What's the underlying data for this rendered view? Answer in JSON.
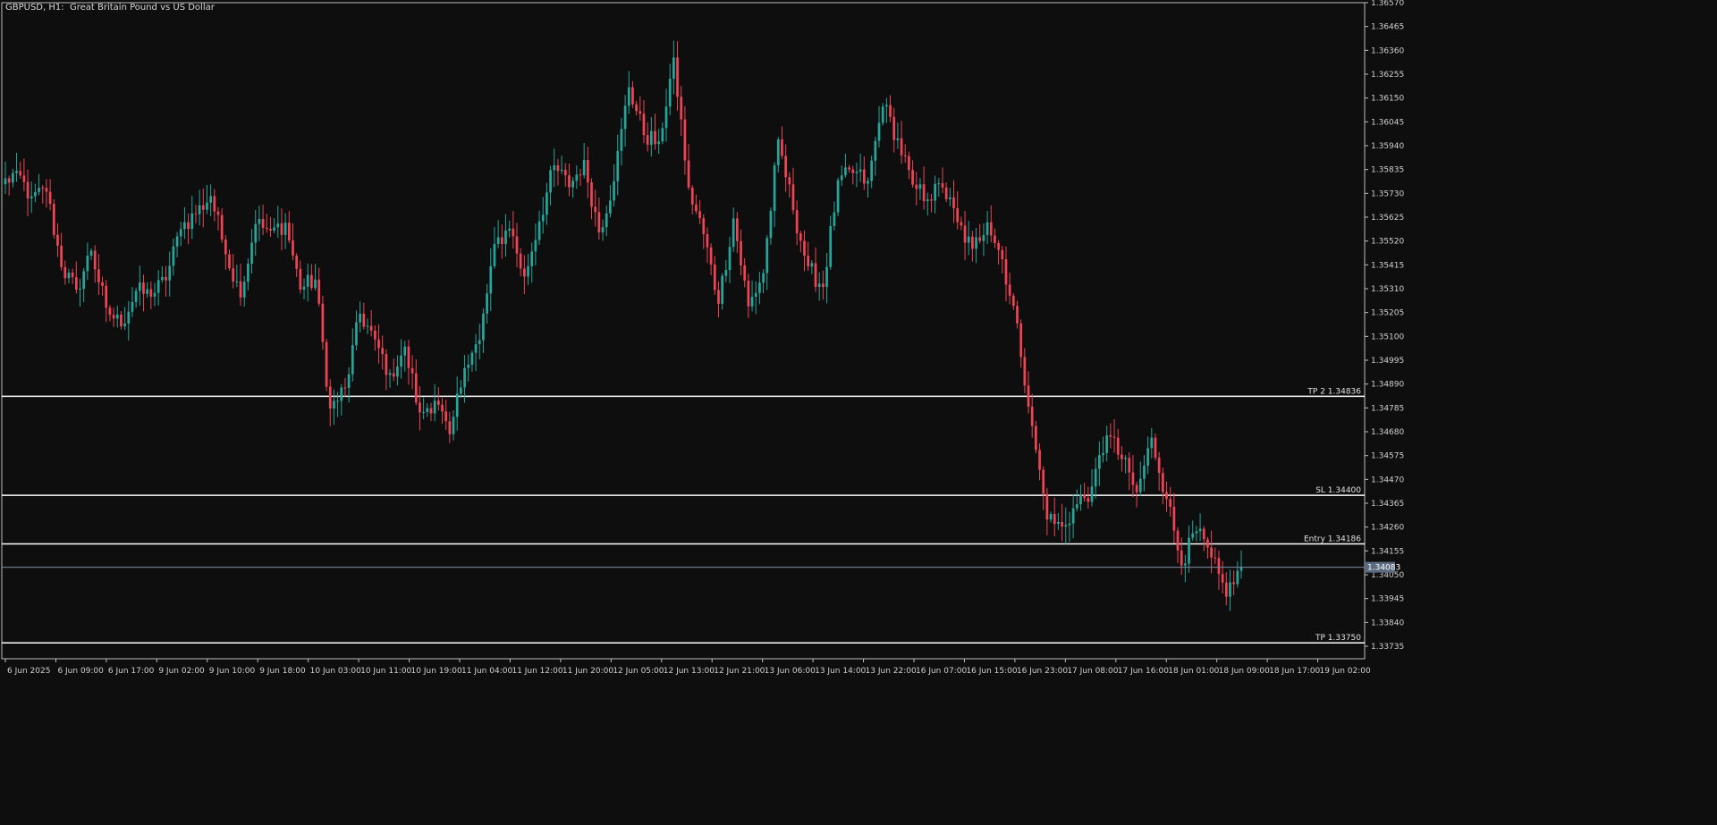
{
  "header": {
    "title": "GBPUSD, H1:  Great Britain Pound vs US Dollar"
  },
  "colors": {
    "background": "#0e0e0e",
    "bull": "#26a69a",
    "bear": "#ef4455",
    "wick_bull": "#26a69a",
    "wick_bear": "#ef4455",
    "axis_text": "#d0d0d0",
    "level_line": "#ffffff",
    "current_price_bg": "#5a6b80",
    "current_price_line": "#7d8ea3"
  },
  "chart_data": {
    "type": "candlestick",
    "symbol": "GBPUSD",
    "timeframe": "H1",
    "ylim": [
      1.3368,
      1.3657
    ],
    "y_ticks": [
      "1.36570",
      "1.36465",
      "1.36360",
      "1.36255",
      "1.36150",
      "1.36045",
      "1.35940",
      "1.35835",
      "1.35730",
      "1.35625",
      "1.35520",
      "1.35415",
      "1.35310",
      "1.35205",
      "1.35100",
      "1.34995",
      "1.34890",
      "1.34785",
      "1.34680",
      "1.34575",
      "1.34470",
      "1.34365",
      "1.34260",
      "1.34155",
      "1.34050",
      "1.33945",
      "1.33840",
      "1.33735"
    ],
    "x_ticks": [
      "6 Jun 2025",
      "6 Jun 09:00",
      "6 Jun 17:00",
      "9 Jun 02:00",
      "9 Jun 10:00",
      "9 Jun 18:00",
      "10 Jun 03:00",
      "10 Jun 11:00",
      "10 Jun 19:00",
      "11 Jun 04:00",
      "11 Jun 12:00",
      "11 Jun 20:00",
      "12 Jun 05:00",
      "12 Jun 13:00",
      "12 Jun 21:00",
      "13 Jun 06:00",
      "13 Jun 14:00",
      "13 Jun 22:00",
      "16 Jun 07:00",
      "16 Jun 15:00",
      "16 Jun 23:00",
      "17 Jun 08:00",
      "17 Jun 16:00",
      "18 Jun 01:00",
      "18 Jun 09:00",
      "18 Jun 17:00",
      "19 Jun 02:00"
    ],
    "levels": [
      {
        "label": "TP 2 1.34836",
        "price": 1.34836
      },
      {
        "label": "SL 1.34400",
        "price": 1.344
      },
      {
        "label": "Entry 1.34186",
        "price": 1.34186
      },
      {
        "label": "TP 1.33750",
        "price": 1.3375
      }
    ],
    "current_price": {
      "label": "1.34083",
      "price": 1.34083
    },
    "anchors": [
      1.3577,
      1.3582,
      1.3571,
      1.3574,
      1.3541,
      1.353,
      1.3548,
      1.3522,
      1.3515,
      1.353,
      1.3528,
      1.3535,
      1.3558,
      1.3564,
      1.3572,
      1.3547,
      1.3528,
      1.356,
      1.3556,
      1.356,
      1.3531,
      1.3535,
      1.3478,
      1.3487,
      1.352,
      1.3508,
      1.3493,
      1.3505,
      1.3476,
      1.3482,
      1.3466,
      1.3497,
      1.3508,
      1.355,
      1.3558,
      1.3536,
      1.3561,
      1.3585,
      1.3576,
      1.3587,
      1.3556,
      1.3579,
      1.362,
      1.3599,
      1.3595,
      1.3632,
      1.3575,
      1.3555,
      1.3525,
      1.3562,
      1.3523,
      1.3538,
      1.3596,
      1.3566,
      1.354,
      1.3532,
      1.3578,
      1.3582,
      1.3578,
      1.3612,
      1.3597,
      1.3576,
      1.3571,
      1.3576,
      1.356,
      1.3548,
      1.3561,
      1.3544,
      1.3515,
      1.347,
      1.343,
      1.3426,
      1.3436,
      1.3443,
      1.3467,
      1.3456,
      1.3441,
      1.3465,
      1.3439,
      1.341,
      1.3424,
      1.3412,
      1.3396,
      1.34083
    ]
  }
}
